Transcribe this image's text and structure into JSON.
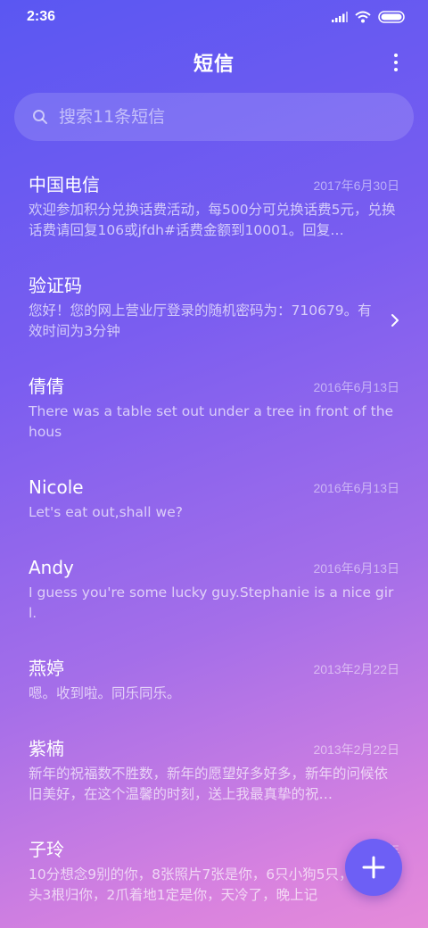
{
  "status_bar": {
    "time": "2:36"
  },
  "header": {
    "title": "短信"
  },
  "search": {
    "placeholder": "搜索11条短信"
  },
  "messages": [
    {
      "name": "中国电信",
      "date": "2017年6月30日",
      "preview": "欢迎参加积分兑换话费活动，每500分可兑换话费5元，兑换话费请回复106或jfdh#话费金额到10001。回复…"
    },
    {
      "name": "验证码",
      "date": "",
      "preview": "您好！您的网上营业厅登录的随机密码为：710679。有效时间为3分钟"
    },
    {
      "name": "倩倩",
      "date": "2016年6月13日",
      "preview": "There was a table set out under a tree in front of the hous"
    },
    {
      "name": "Nicole",
      "date": "2016年6月13日",
      "preview": "Let's eat out,shall we?"
    },
    {
      "name": "Andy",
      "date": "2016年6月13日",
      "preview": "I guess you're some lucky guy.Stephanie is a nice girl."
    },
    {
      "name": "燕婷",
      "date": "2013年2月22日",
      "preview": "嗯。收到啦。同乐同乐。"
    },
    {
      "name": "紫楠",
      "date": "2013年2月22日",
      "preview": "新年的祝福数不胜数，新年的愿望好多好多，新年的问候依旧美好，在这个温馨的时刻，送上我最真挚的祝…"
    },
    {
      "name": "子玲",
      "date": "2013年",
      "preview": "10分想念9别的你，8张照片7张是你，6只小狗5只，4根骨头3根归你，2爪着地1定是你，天冷了，晚上记"
    }
  ],
  "icons": {
    "signal": "signal-icon",
    "wifi": "wifi-icon",
    "battery": "battery-icon",
    "more": "more-vertical-icon",
    "search": "search-icon",
    "chevron": "chevron-right-icon",
    "compose": "plus-icon"
  },
  "colors": {
    "gradient_start": "#5a57f2",
    "gradient_end": "#e58bd9",
    "fab": "#6d5ff5"
  }
}
